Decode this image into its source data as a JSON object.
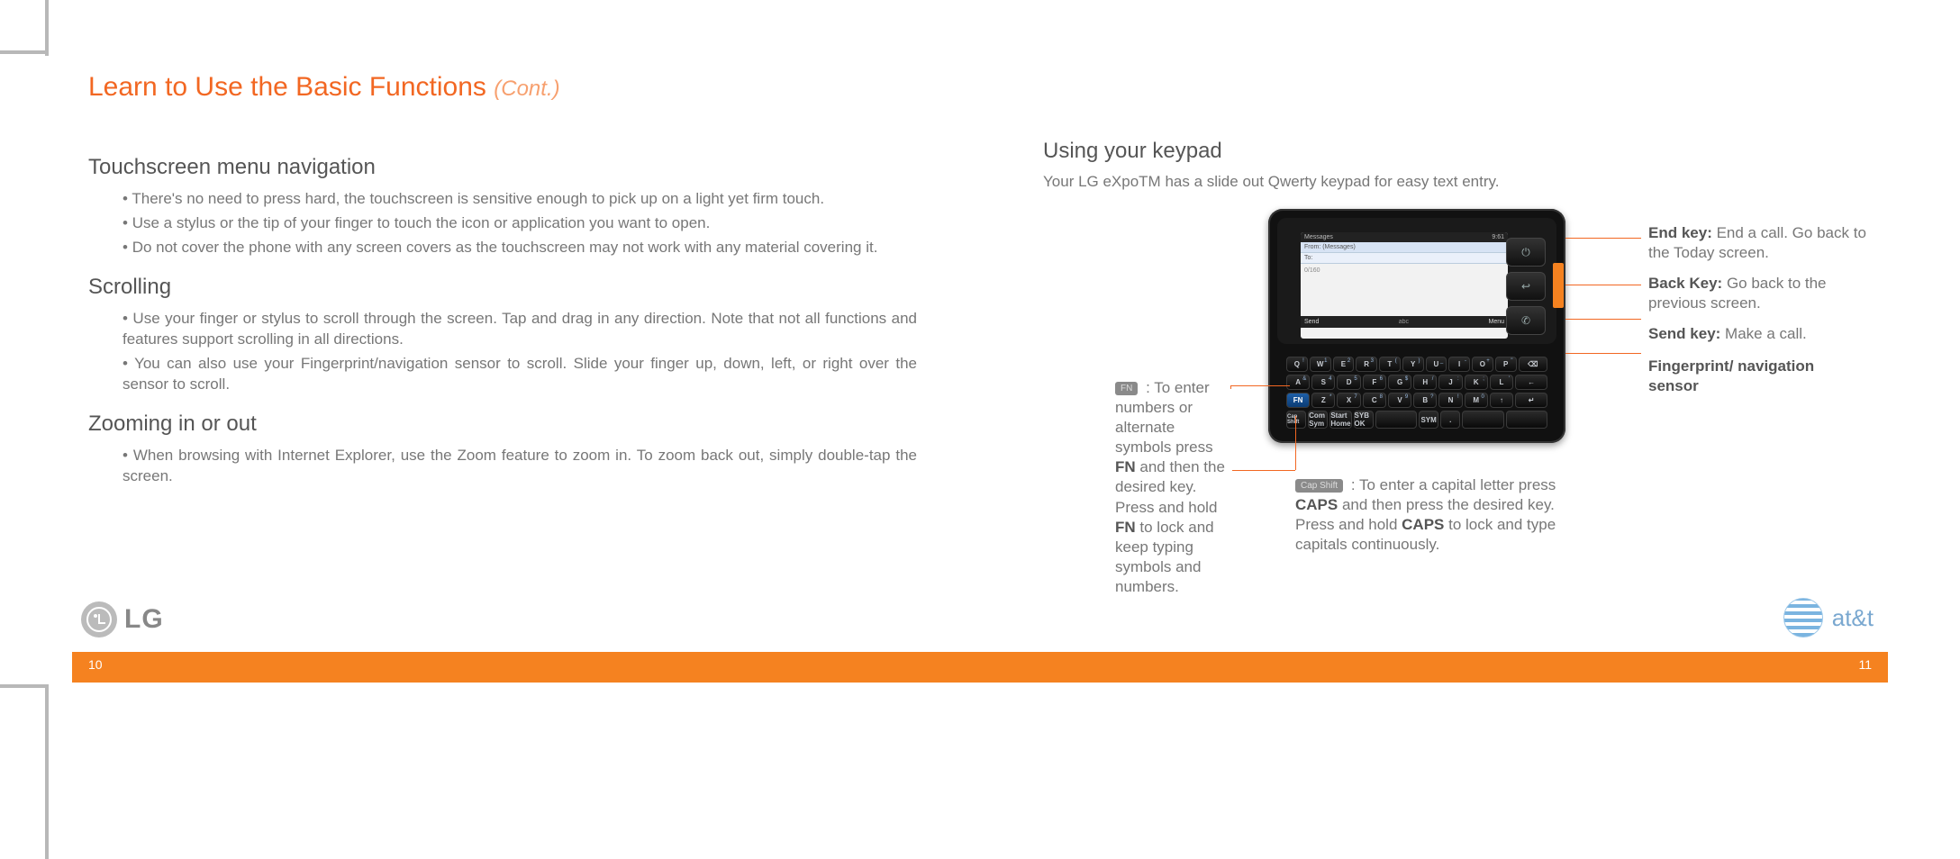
{
  "title": "Learn to Use the Basic Functions",
  "title_cont": "(Cont.)",
  "left": {
    "h1": "Touchscreen menu navigation",
    "h1_items": [
      "There's no need to press hard, the touchscreen is sensitive enough to pick up on a light yet firm touch.",
      "Use a stylus or the tip of your finger to touch the icon or application you want to open.",
      "Do not cover the phone with any screen covers as the touchscreen may not work with any material covering it."
    ],
    "h2": "Scrolling",
    "h2_items": [
      "Use your finger or stylus to scroll through the screen. Tap and drag in any direction. Note that not all functions and features support scrolling in all directions.",
      "You can also use your Fingerprint/navigation sensor to scroll. Slide your finger up, down, left, or right over the sensor to scroll."
    ],
    "h3": "Zooming in or out",
    "h3_items": [
      "When browsing with Internet Explorer, use the Zoom feature to zoom in. To zoom back out, simply double-tap the screen."
    ]
  },
  "right": {
    "h1": "Using your keypad",
    "intro": "Your LG eXpoTM has a slide out Qwerty keypad for easy text entry.",
    "screen": {
      "app": "Messages",
      "time": "9:61",
      "from": "From: (Messages)",
      "to": "To:",
      "count": "0/160",
      "soft_left": "Send",
      "soft_mid": "abc",
      "soft_right": "Menu"
    },
    "keys": {
      "row1": [
        "Q",
        "W",
        "E",
        "R",
        "T",
        "Y",
        "U",
        "I",
        "O",
        "P"
      ],
      "row1_sup": [
        "!",
        "1",
        "2",
        "3",
        "(",
        ")",
        "_",
        "-",
        "+",
        "\""
      ],
      "row2_lead": "A",
      "row2": [
        "S",
        "D",
        "F",
        "G",
        "H",
        "J",
        "K",
        "L"
      ],
      "row2_end": "←",
      "row2_sup": [
        "&",
        "4",
        "5",
        "6",
        "$",
        "/",
        ":",
        ";",
        "'"
      ],
      "fn": "FN",
      "row3": [
        "Z",
        "X",
        "C",
        "V",
        "B",
        "N",
        "M"
      ],
      "row3_sup": [
        "*",
        "7",
        "8",
        "9",
        "?",
        "!",
        "0",
        ","
      ],
      "caps": "Cap Shift",
      "row4": [
        "Com Sym",
        "Start Home",
        "SYB OK",
        "",
        "SYM",
        ".",
        "",
        ""
      ]
    },
    "callouts": {
      "end": {
        "b": "End key:",
        "t": " End a call. Go back to the Today screen."
      },
      "back": {
        "b": "Back Key:",
        "t": " Go back to the previous screen."
      },
      "send": {
        "b": "Send key:",
        "t": " Make a call."
      },
      "fp": {
        "b": "Fingerprint/ navigation sensor",
        "t": ""
      },
      "fn_cap": "FN",
      "fn": " : To enter numbers or alternate symbols press FN and then the desired key. Press and hold FN to lock and keep typing symbols and numbers.",
      "caps_cap": "Cap Shift",
      "caps": " : To enter a capital letter press CAPS and then press the desired key. Press and hold CAPS to lock and type capitals continuously."
    }
  },
  "page_left": "10",
  "page_right": "11",
  "lg": "LG",
  "att": "at&t"
}
